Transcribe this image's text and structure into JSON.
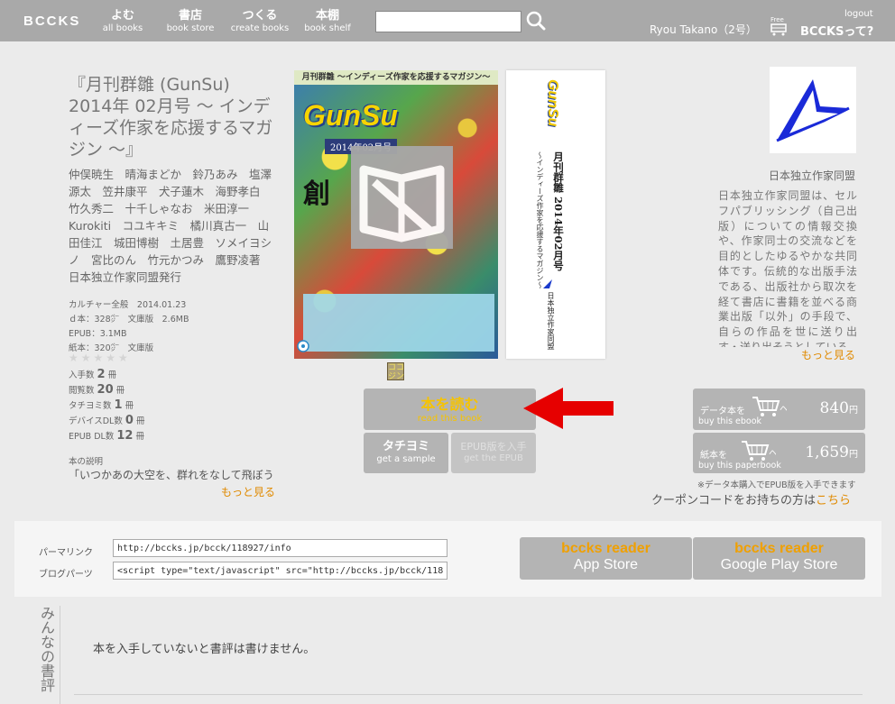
{
  "header": {
    "logo": "BCCKS",
    "nav": [
      {
        "jp": "よむ",
        "en": "all books"
      },
      {
        "jp": "書店",
        "en": "book store"
      },
      {
        "jp": "つくる",
        "en": "create books"
      },
      {
        "jp": "本棚",
        "en": "book shelf"
      }
    ],
    "search_value": "",
    "user": "Ryou Takano（2号）",
    "free_label": "Free",
    "logout": "logout",
    "about": "BCCKSって?"
  },
  "book": {
    "title": "『月刊群雛 (GunSu) 2014年 02月号 〜 インディーズ作家を応援するマガジン 〜』",
    "authors": "仲俣暁生　晴海まどか　鈴乃あみ　塩澤源太　笠井康平　犬子蓮木　海野孝白　竹久秀二　十千しゃなお　米田淳一　Kurokiti　コユキキミ　橘川真古一　山田佳江　城田博樹　土居豊　ソメイヨシノ　宮比のん　竹元かつみ　鷹野凌著　日本独立作家同盟発行",
    "meta": [
      "カルチャー全般　2014.01.23",
      "ｄ本：328㌻　文庫版　2.6MB",
      "EPUB：3.1MB",
      "紙本：320㌻　文庫版"
    ],
    "stars": "★★★★★",
    "stats": [
      {
        "label": "入手数",
        "value": "2",
        "unit": "冊"
      },
      {
        "label": "閲覧数",
        "value": "20",
        "unit": "冊"
      },
      {
        "label": "タチヨミ数",
        "value": "1",
        "unit": "冊"
      },
      {
        "label": "デバイスDL数",
        "value": "0",
        "unit": "冊"
      },
      {
        "label": "EPUB DL数",
        "value": "12",
        "unit": "冊"
      }
    ],
    "description_label": "本の説明",
    "description": "「いつかあの大空を、群れをなして飛ぼう",
    "more": "もっと見る"
  },
  "cover": {
    "top_text": "月刊群雛 〜インディーズ作家を応援するマガジン〜",
    "logo": "GunSu",
    "date": "2014年02月号",
    "kanji": "創",
    "icon_koko": "ココ\nジン"
  },
  "spine": {
    "logo": "GunSu",
    "title": "月刊群雛 2014年02月号",
    "subtitle": "〜インディーズ作家を応援するマガジン〜",
    "publisher": "日本独立作家同盟"
  },
  "actions": {
    "read_jp": "本を読む",
    "read_en": "read this book",
    "sample_jp": "タチヨミ",
    "sample_en": "get a sample",
    "epub_jp": "EPUB版を入手",
    "epub_en": "get the EPUB"
  },
  "publisher": {
    "name": "日本独立作家同盟",
    "description": "日本独立作家同盟は、セルフパブリッシング（自己出版）についての情報交換や、作家同士の交流などを目的としたゆるやかな共同体です。伝統的な出版手法である、出版社から取次を経て書店に書籍を並べる商業出版「以外」の手段で、自らの作品を世に送り出す・送り出そうとしている",
    "more": "もっと見る"
  },
  "purchase": {
    "ebook_jp": "データ本を",
    "ebook_en": "buy this ebook",
    "ebook_price": "840",
    "paper_jp": "紙本を",
    "paper_en": "buy this paperbook",
    "paper_price": "1,659",
    "currency": "円",
    "note": "※データ本購入でEPUB版を入手できます",
    "coupon": "クーポンコードをお持ちの方は",
    "coupon_link": "こちら"
  },
  "share": {
    "permalink_label": "パーマリンク",
    "permalink": "http://bccks.jp/bcck/118927/info",
    "blog_label": "ブログパーツ",
    "blog": "<script type=\"text/javascript\" src=\"http://bccks.jp/bcck/118927",
    "reader_brand": "bccks reader",
    "appstore": "App Store",
    "googleplay": "Google Play Store"
  },
  "reviews": {
    "heading": "みんなの書評",
    "note": "本を入手していないと書評は書けません。"
  },
  "colors": {
    "header": "#a9a9a9",
    "accent_orange": "#e08a00",
    "read_yellow": "#f6c300",
    "arrow_red": "#e60000"
  }
}
